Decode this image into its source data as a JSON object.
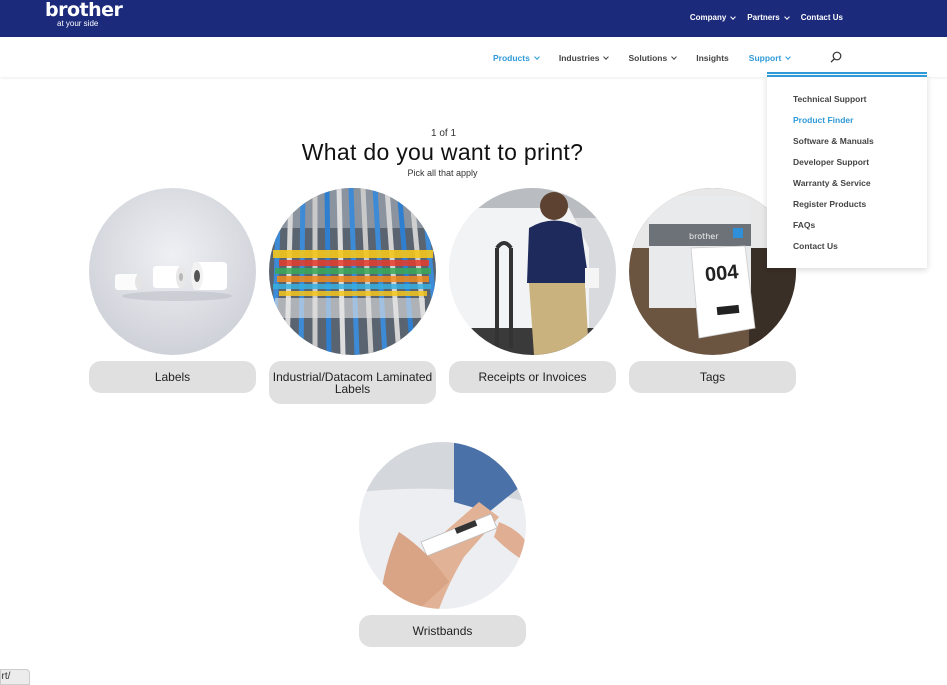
{
  "brand": {
    "name": "brother",
    "tagline": "at your side"
  },
  "topnav": [
    {
      "label": "Company",
      "has_menu": true
    },
    {
      "label": "Partners",
      "has_menu": true
    },
    {
      "label": "Contact Us",
      "has_menu": false
    }
  ],
  "mainnav": [
    {
      "label": "Products",
      "has_menu": true,
      "active": true
    },
    {
      "label": "Industries",
      "has_menu": true
    },
    {
      "label": "Solutions",
      "has_menu": true
    },
    {
      "label": "Insights",
      "has_menu": false
    },
    {
      "label": "Support",
      "has_menu": true,
      "active": true
    }
  ],
  "support_menu": [
    "Technical Support",
    "Product Finder",
    "Software & Manuals",
    "Developer Support",
    "Warranty & Service",
    "Register Products",
    "FAQs",
    "Contact Us"
  ],
  "finder": {
    "step": "1 of 1",
    "question": "What do you want to print?",
    "hint": "Pick all that apply",
    "options": [
      {
        "label": "Labels"
      },
      {
        "label": "Industrial/Datacom Laminated Labels"
      },
      {
        "label": "Receipts or Invoices"
      },
      {
        "label": "Tags"
      },
      {
        "label": "Wristbands"
      }
    ]
  },
  "tag_image_text": {
    "brand": "brother",
    "number": "004"
  },
  "status_url": "ort/",
  "colors": {
    "topbar": "#1b2a7a",
    "accent": "#2f9ad8",
    "pill": "#e0e0e0"
  }
}
